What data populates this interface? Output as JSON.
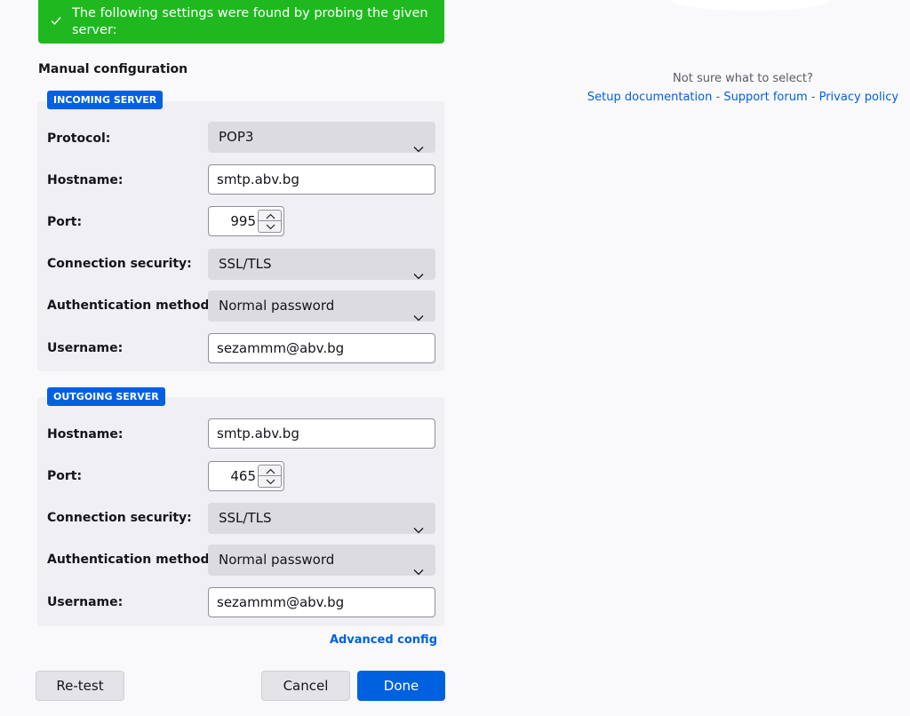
{
  "banner": {
    "message": "The following settings were found by probing the given server:",
    "color": "#1fb91f"
  },
  "section_title": "Manual configuration",
  "incoming": {
    "badge": "INCOMING SERVER",
    "protocol": {
      "label": "Protocol:",
      "value": "POP3"
    },
    "hostname": {
      "label": "Hostname:",
      "value": "smtp.abv.bg"
    },
    "port": {
      "label": "Port:",
      "value": "995"
    },
    "security": {
      "label": "Connection security:",
      "value": "SSL/TLS"
    },
    "auth": {
      "label": "Authentication method:",
      "value": "Normal password"
    },
    "username": {
      "label": "Username:",
      "value": "sezammm@abv.bg"
    }
  },
  "outgoing": {
    "badge": "OUTGOING SERVER",
    "hostname": {
      "label": "Hostname:",
      "value": "smtp.abv.bg"
    },
    "port": {
      "label": "Port:",
      "value": "465"
    },
    "security": {
      "label": "Connection security:",
      "value": "SSL/TLS"
    },
    "auth": {
      "label": "Authentication method:",
      "value": "Normal password"
    },
    "username": {
      "label": "Username:",
      "value": "sezammm@abv.bg"
    }
  },
  "advanced_link": "Advanced config",
  "buttons": {
    "retest": "Re-test",
    "cancel": "Cancel",
    "done": "Done"
  },
  "help": {
    "question": "Not sure what to select?",
    "setup_docs": "Setup documentation",
    "separator": " - ",
    "support_forum": "Support forum",
    "privacy_policy": "Privacy policy"
  },
  "colors": {
    "accent": "#0061e0",
    "success": "#1fb91f"
  },
  "icons": {
    "banner": "checkmark-icon",
    "dropdown": "chevron-down-icon",
    "stepper": "chevron-up-down-icon"
  }
}
